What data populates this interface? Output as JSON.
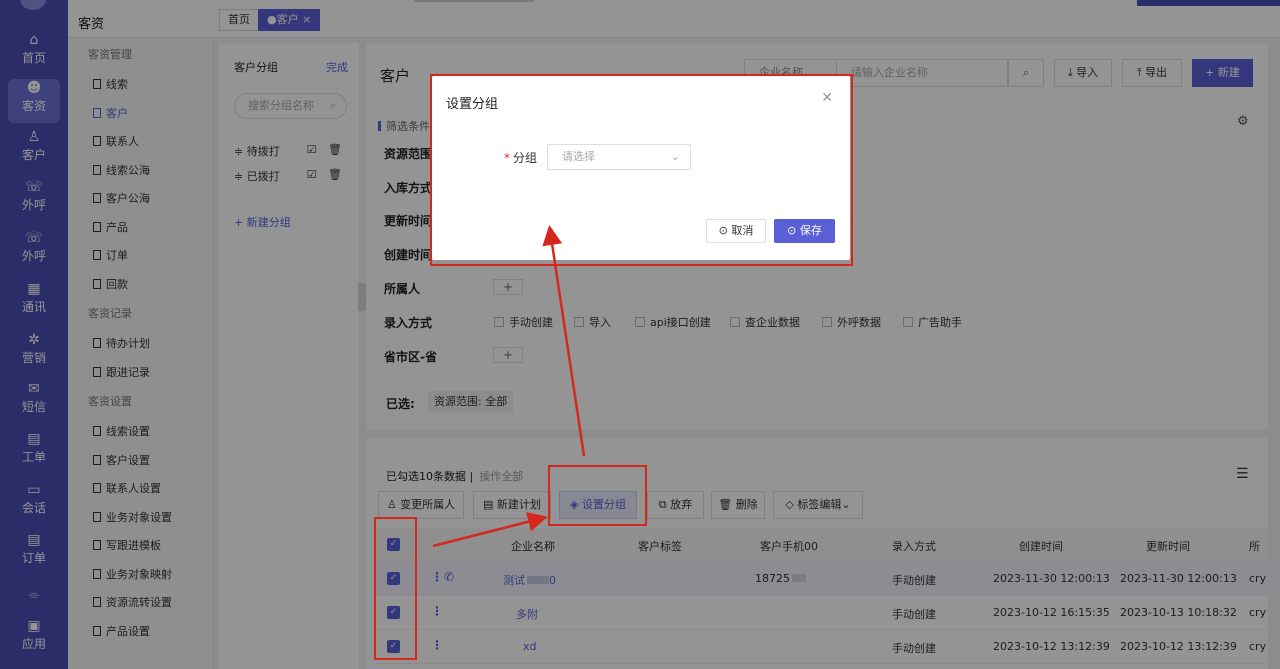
{
  "nav": {
    "items": [
      {
        "label": "首页",
        "icon": "home-icon",
        "glyph": "⌂"
      },
      {
        "label": "客资",
        "icon": "users-icon",
        "glyph": "☻"
      },
      {
        "label": "客户",
        "icon": "person-icon",
        "glyph": "♙"
      },
      {
        "label": "外呼",
        "icon": "phone-out-icon",
        "glyph": "☏"
      },
      {
        "label": "外呼",
        "icon": "phone-out-icon",
        "glyph": "☏"
      },
      {
        "label": "通讯",
        "icon": "contacts-icon",
        "glyph": "▦"
      },
      {
        "label": "营销",
        "icon": "gear-icon",
        "glyph": "✲"
      },
      {
        "label": "短信",
        "icon": "sms-icon",
        "glyph": "✉"
      },
      {
        "label": "工单",
        "icon": "clipboard-icon",
        "glyph": "▤"
      },
      {
        "label": "会话",
        "icon": "chat-icon",
        "glyph": "▭"
      },
      {
        "label": "订单",
        "icon": "order-icon",
        "glyph": "▤"
      },
      {
        "label": "",
        "icon": "divider-icon",
        "glyph": "⌯"
      },
      {
        "label": "应用",
        "icon": "apps-icon",
        "glyph": "▣"
      }
    ]
  },
  "topbar": {
    "module": "客资",
    "tabs": [
      "首页",
      "●客户 ×"
    ]
  },
  "menu": {
    "sections": [
      {
        "title": "客资管理",
        "items": [
          "线索",
          "客户",
          "联系人",
          "线索公海",
          "客户公海",
          "产品",
          "订单",
          "回款"
        ]
      },
      {
        "title": "客资记录",
        "items": [
          "待办计划",
          "跟进记录"
        ]
      },
      {
        "title": "客资设置",
        "items": [
          "线索设置",
          "客户设置",
          "联系人设置",
          "业务对象设置",
          "写跟进模板",
          "业务对象映射",
          "资源流转设置",
          "产品设置"
        ]
      }
    ]
  },
  "groups": {
    "title": "客户分组",
    "done": "完成",
    "search_placeholder": "搜索分组名称",
    "items": [
      "待拨打",
      "已拨打"
    ],
    "ops": "☑ 🗑",
    "new_group": "+ 新建分组"
  },
  "main": {
    "title": "客户",
    "search_field": "企业名称",
    "search_placeholder": "请输入企业名称",
    "import_label": "⤓ 导入",
    "export_label": "⤒ 导出",
    "new_label": "+ 新建",
    "filter_header": "筛选条件",
    "filters": [
      "资源范围",
      "入库方式",
      "更新时间",
      "创建时间",
      "所属人",
      "录入方式",
      "省市区-省"
    ],
    "entry_methods": [
      "手动创建",
      "导入",
      "api接口创建",
      "查企业数据",
      "外呼数据",
      "广告助手"
    ],
    "selected_label": "已选:",
    "selected_tag": "资源范围: 全部"
  },
  "list": {
    "selected_info": "已勾选10条数据 |",
    "select_all": "操作全部",
    "actions": [
      "♙ 变更所属人",
      "▤ 新建计划",
      "◈ 设置分组",
      "⧉ 放弃",
      "🗑 删除",
      "◇ 标签编辑⌄"
    ],
    "columns": [
      "企业名称",
      "客户标签",
      "客户手机00",
      "录入方式",
      "创建时间",
      "更新时间",
      "所"
    ],
    "rows": [
      {
        "name": "测试",
        "name_tail": "0",
        "phone": "18725",
        "method": "手动创建",
        "created": "2023-11-30 12:00:13",
        "updated": "2023-11-30 12:00:13",
        "extra": "cry"
      },
      {
        "name": "多附",
        "name_tail": "",
        "phone": "",
        "method": "手动创建",
        "created": "2023-10-12 16:15:35",
        "updated": "2023-10-13 10:18:32",
        "extra": "cry"
      },
      {
        "name": "xd",
        "name_tail": "",
        "phone": "",
        "method": "手动创建",
        "created": "2023-10-12 13:12:39",
        "updated": "2023-10-12 13:12:39",
        "extra": "cry"
      }
    ]
  },
  "modal": {
    "title": "设置分组",
    "field_label": "分组",
    "required_mark": "*",
    "placeholder": "请选择",
    "cancel": "⊙ 取消",
    "save": "⊙ 保存"
  },
  "colors": {
    "accent": "#5b5fd6",
    "nav": "#4a4fb5",
    "annotation": "#d4281c"
  }
}
